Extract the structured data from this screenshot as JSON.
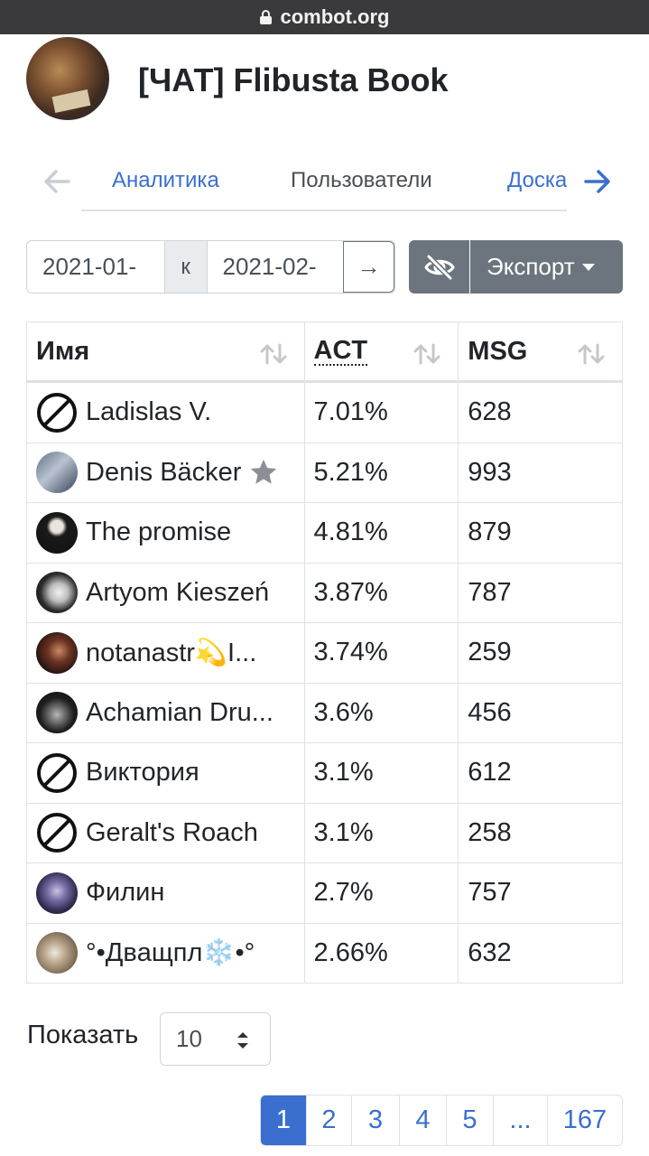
{
  "browser": {
    "url": "combot.org"
  },
  "header": {
    "title": "[ЧАТ] Flibusta Book"
  },
  "tabs": [
    {
      "label": "Аналитика"
    },
    {
      "label": "Пользователи"
    },
    {
      "label": "Доска"
    }
  ],
  "filters": {
    "date_from": "2021-01-",
    "separator": "к",
    "date_to": "2021-02-",
    "go_symbol": "→",
    "export_label": "Экспорт"
  },
  "table": {
    "columns": [
      "Имя",
      "ACT",
      "MSG"
    ],
    "rows": [
      {
        "name": "Ladislas V.",
        "act": "7.01%",
        "msg": "628",
        "avatar": "ban-icon"
      },
      {
        "name": "Denis Bäcker",
        "act": "5.21%",
        "msg": "993",
        "avatar": "photo",
        "starred": true
      },
      {
        "name": "The promise",
        "act": "4.81%",
        "msg": "879",
        "avatar": "photo"
      },
      {
        "name": "Artyom Kieszeń",
        "act": "3.87%",
        "msg": "787",
        "avatar": "photo"
      },
      {
        "name": "notanastr💫I...",
        "act": "3.74%",
        "msg": "259",
        "avatar": "photo"
      },
      {
        "name": "Achamian Dru...",
        "act": "3.6%",
        "msg": "456",
        "avatar": "photo"
      },
      {
        "name": "Виктория",
        "act": "3.1%",
        "msg": "612",
        "avatar": "ban-icon"
      },
      {
        "name": "Geralt's Roach",
        "act": "3.1%",
        "msg": "258",
        "avatar": "ban-icon"
      },
      {
        "name": "Филин",
        "act": "2.7%",
        "msg": "757",
        "avatar": "photo"
      },
      {
        "name": "°•Двaщпл❄️•°",
        "act": "2.66%",
        "msg": "632",
        "avatar": "photo"
      }
    ]
  },
  "footer": {
    "show_label": "Показать",
    "page_size": "10",
    "pages": [
      "1",
      "2",
      "3",
      "4",
      "5",
      "...",
      "167"
    ],
    "current_page": "1"
  },
  "colors": {
    "accent": "#3a6fcf",
    "button_gray": "#6c757d",
    "border": "#dee2e6",
    "urlbar": "#3a3a3c"
  }
}
